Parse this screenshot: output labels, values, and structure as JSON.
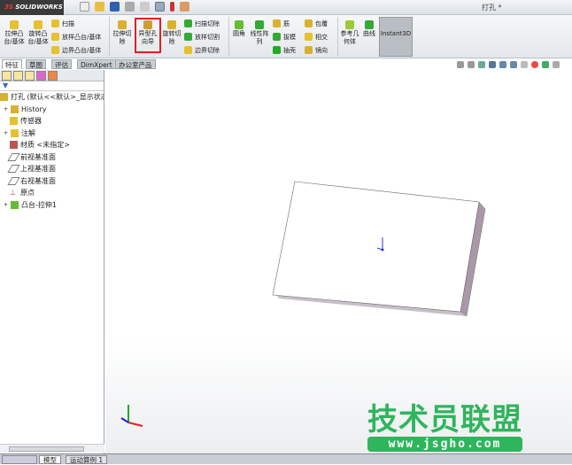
{
  "app": {
    "logo": "SOLIDWORKS",
    "title": "打孔 *"
  },
  "ribbon": {
    "extrude_boss": "拉伸凸台/基体",
    "revolve_boss": "旋转凸台/基体",
    "sweep": "扫描",
    "loft": "放样凸台/基体",
    "boundary": "边界凸台/基体",
    "extrude_cut": "拉伸切除",
    "hole_wizard": "异型孔向导",
    "revolve_cut": "旋转切除",
    "sweep_cut": "扫描切除",
    "loft_cut": "放样切割",
    "boundary_cut": "边界切除",
    "fillet": "圆角",
    "linear_pattern": "线性阵列",
    "rib": "筋",
    "draft": "拔模",
    "shell": "抽壳",
    "wrap": "包覆",
    "intersect": "相交",
    "mirror": "镜向",
    "ref_geometry": "参考几何体",
    "curves": "曲线",
    "instant3d": "Instant3D"
  },
  "tabs": [
    "特征",
    "草图",
    "评估",
    "DimXpert",
    "办公室产品"
  ],
  "tree": {
    "root": "打孔 (默认<<默认>_显示状态",
    "items": [
      "History",
      "传感器",
      "注解",
      "材质 <未指定>",
      "前视基准面",
      "上视基准面",
      "右视基准面",
      "原点",
      "凸台-拉伸1"
    ]
  },
  "bottom_tabs": [
    "模型",
    "运动算例 1"
  ],
  "watermark": {
    "name": "技术员联盟",
    "url": "www.jsgho.com"
  },
  "colors": {
    "accent": "#e02020",
    "watermark": "#2fb55c",
    "part_face": "#ffffff",
    "part_side": "#a898a8"
  }
}
